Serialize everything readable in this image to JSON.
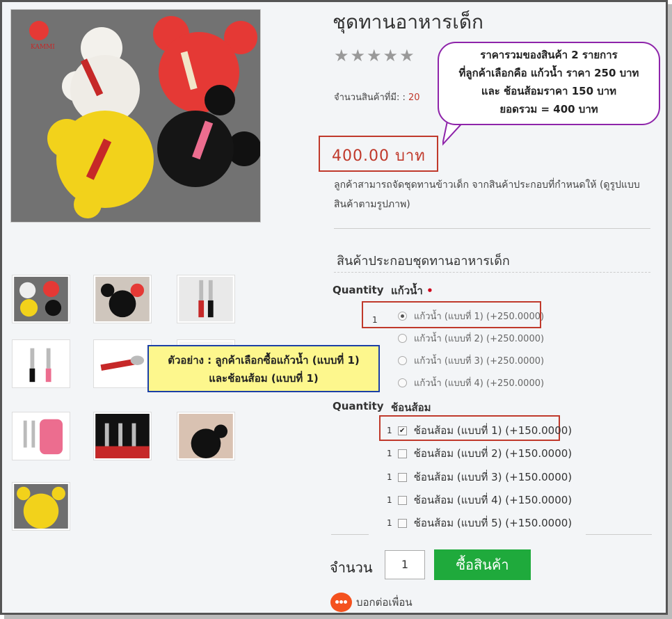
{
  "product": {
    "title": "ชุดทานอาหารเด็ก",
    "stars": "★★★★★",
    "stock_label": "จำนวนสินค้าที่มี: :",
    "stock_value": "20",
    "price": "400.00 บาท",
    "description": "ลูกค้าสามารถจัดชุดทานข้าวเด็ก จากสินค้าประกอบที่กำหนดให้ (ดูรูปแบบสินค้าตามรูปภาพ)"
  },
  "options": {
    "section_title": "สินค้าประกอบชุดทานอาหารเด็ก",
    "quantity_label": "Quantity",
    "group1": {
      "name": "แก้วน้ำ",
      "required_mark": "•",
      "qty": "1",
      "items": [
        "แก้วน้ำ (แบบที่ 1) (+250.0000)",
        "แก้วน้ำ (แบบที่ 2) (+250.0000)",
        "แก้วน้ำ (แบบที่ 3) (+250.0000)",
        "แก้วน้ำ (แบบที่ 4) (+250.0000)"
      ],
      "selected_index": 0
    },
    "group2": {
      "name": "ช้อนส้อม",
      "qtys": [
        "1",
        "1",
        "1",
        "1",
        "1"
      ],
      "items": [
        "ช้อนส้อม (แบบที่ 1) (+150.0000)",
        "ช้อนส้อม (แบบที่ 2) (+150.0000)",
        "ช้อนส้อม (แบบที่ 3) (+150.0000)",
        "ช้อนส้อม (แบบที่ 4) (+150.0000)",
        "ช้อนส้อม (แบบที่ 5) (+150.0000)"
      ],
      "checked_index": 0,
      "check_mark": "✔"
    }
  },
  "cart": {
    "qty_label": "จำนวน",
    "qty_value": "1",
    "buy_label": "ซื้อสินค้า",
    "share_label": "บอกต่อเพื่อน"
  },
  "annotations": {
    "callout_lines": [
      "ราคารวมของสินค้า 2 รายการ",
      "ที่ลูกค้าเลือกคือ แก้วน้ำ ราคา 250 บาท",
      "และ ช้อนส้อมราคา 150 บาท",
      "ยอดรวม = 400 บาท"
    ],
    "note_lines": [
      "ตัวอย่าง : ลูกค้าเลือกซื้อแก้วน้ำ (แบบที่ 1)",
      "และช้อนส้อม (แบบที่ 1)"
    ]
  },
  "colors": {
    "price_red": "#c0392b",
    "buy_green": "#1faa3c",
    "callout_border": "#8e24aa",
    "note_bg": "#fdf78d",
    "note_border": "#1a3fa6"
  }
}
